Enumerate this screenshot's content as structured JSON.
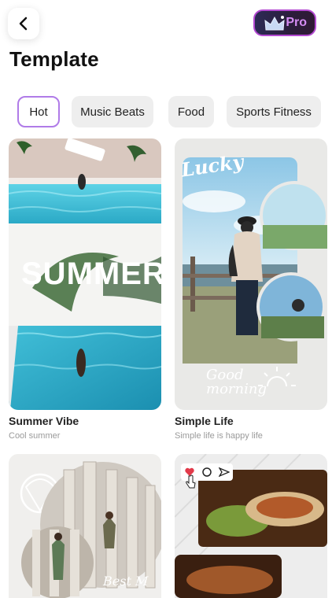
{
  "header": {
    "back_icon": "chevron-left-icon",
    "pro_label": "Pro",
    "pro_icon": "crown-icon"
  },
  "page": {
    "title": "Template"
  },
  "categories": [
    {
      "label": "Hot",
      "active": true
    },
    {
      "label": "Music Beats",
      "active": false
    },
    {
      "label": "Food",
      "active": false
    },
    {
      "label": "Sports Fitness",
      "active": false
    }
  ],
  "templates": [
    {
      "title": "Summer Vibe",
      "subtitle": "Cool summer",
      "overlay": "SUMMER"
    },
    {
      "title": "Simple Life",
      "subtitle": "Simple life is happy life",
      "overlay_top": "Lucky",
      "overlay_bottom": "Good morning"
    },
    {
      "overlay": "Best M"
    },
    {
      "icons": [
        "heart-icon",
        "comment-icon",
        "send-icon"
      ]
    }
  ],
  "colors": {
    "accent": "#b07be8",
    "pro_text": "#d58cf3",
    "chip_bg": "#eeeeee"
  }
}
